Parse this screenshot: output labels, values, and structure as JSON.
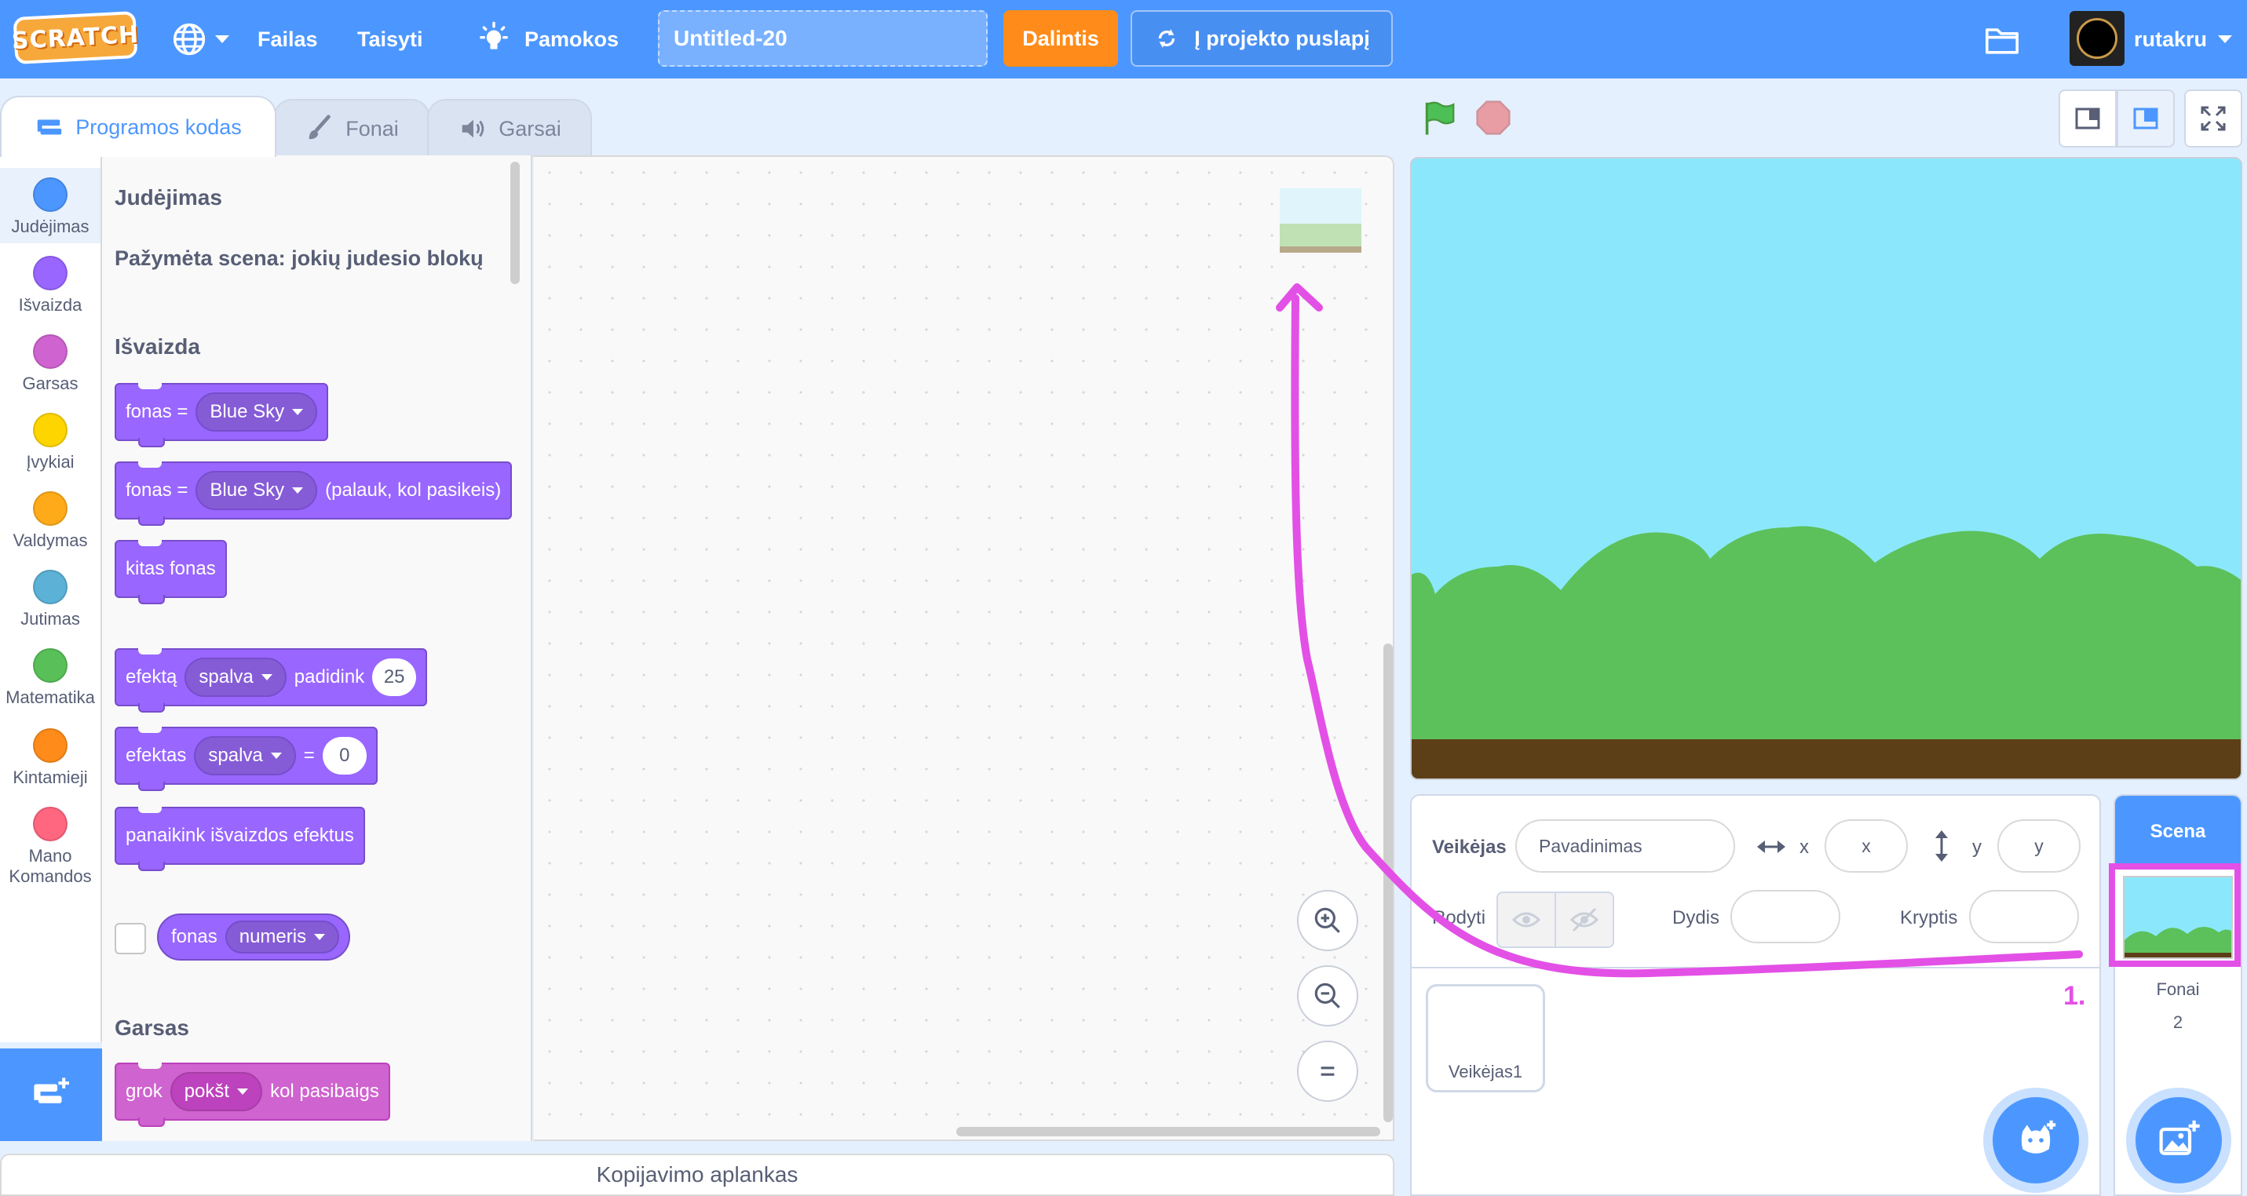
{
  "menu": {
    "logo": "SCRATCH",
    "file": "Failas",
    "edit": "Taisyti",
    "tutorials": "Pamokos",
    "project_title": "Untitled-20",
    "share": "Dalintis",
    "project_page": "Į projekto puslapį",
    "username": "rutakru"
  },
  "tabs": [
    {
      "label": "Programos kodas",
      "active": true
    },
    {
      "label": "Fonai",
      "active": false
    },
    {
      "label": "Garsai",
      "active": false
    }
  ],
  "categories": [
    {
      "label": "Judėjimas",
      "color": "#4c97ff"
    },
    {
      "label": "Išvaizda",
      "color": "#9966ff"
    },
    {
      "label": "Garsas",
      "color": "#cf63cf"
    },
    {
      "label": "Įvykiai",
      "color": "#ffd500"
    },
    {
      "label": "Valdymas",
      "color": "#ffab19"
    },
    {
      "label": "Jutimas",
      "color": "#5cb1d6"
    },
    {
      "label": "Matematika",
      "color": "#59c059"
    },
    {
      "label": "Kintamieji",
      "color": "#ff8c1a"
    },
    {
      "label": "Mano Komandos",
      "color": "#ff6680"
    }
  ],
  "palette": {
    "motion_heading": "Judėjimas",
    "motion_note": "Pažymėta scena: jokių judesio blokų",
    "looks_heading": "Išvaizda",
    "sound_heading": "Garsas",
    "blocks": {
      "switch_backdrop": {
        "prefix": "fonas =",
        "value": "Blue Sky"
      },
      "switch_backdrop_wait": {
        "prefix": "fonas =",
        "value": "Blue Sky",
        "suffix": "(palauk, kol pasikeis)"
      },
      "next_backdrop": "kitas  fonas",
      "change_effect": {
        "prefix": "efektą",
        "effect": "spalva",
        "mid": "padidink",
        "value": "25"
      },
      "set_effect": {
        "prefix": "efektas",
        "effect": "spalva",
        "mid": "=",
        "value": "0"
      },
      "clear_effects": "panaikink išvaizdos efektus",
      "backdrop_reporter": {
        "prefix": "fonas",
        "value": "numeris"
      },
      "play_sound": {
        "prefix": "grok",
        "value": "pokšt",
        "suffix": "kol pasibaigs"
      }
    }
  },
  "backpack": "Kopijavimo aplankas",
  "sprite_info": {
    "sprite_label": "Veikėjas",
    "name_placeholder": "Pavadinimas",
    "x_label": "x",
    "x_placeholder": "x",
    "y_label": "y",
    "y_placeholder": "y",
    "show_label": "Rodyti",
    "size_label": "Dydis",
    "direction_label": "Kryptis"
  },
  "sprites": [
    {
      "name": "Veikėjas1"
    }
  ],
  "stage_selector": {
    "title": "Scena",
    "backdrops_label": "Fonai",
    "backdrops_count": "2"
  },
  "annotation": {
    "number": "1.",
    "color": "#e350e6"
  }
}
